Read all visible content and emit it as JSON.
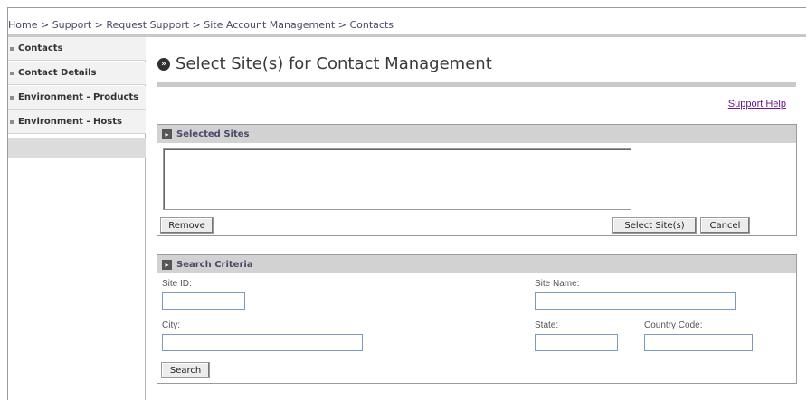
{
  "breadcrumb": "Home > Support > Request Support > Site Account Management > Contacts",
  "sidebar": {
    "items": [
      {
        "label": "Contacts"
      },
      {
        "label": "Contact Details"
      },
      {
        "label": "Environment - Products"
      },
      {
        "label": "Environment - Hosts"
      }
    ]
  },
  "page": {
    "title_icon": "»",
    "title": "Select Site(s) for Contact Management",
    "help_link": "Support Help"
  },
  "selected_sites": {
    "header": "Selected Sites",
    "list_value": "",
    "remove_label": "Remove",
    "select_label": "Select Site(s)",
    "cancel_label": "Cancel"
  },
  "search": {
    "header": "Search Criteria",
    "site_id_label": "Site ID:",
    "site_id_value": "",
    "site_name_label": "Site Name:",
    "site_name_value": "",
    "city_label": "City:",
    "city_value": "",
    "state_label": "State:",
    "state_value": "",
    "country_label": "Country Code:",
    "country_value": "",
    "search_label": "Search"
  },
  "colors": {
    "section_header_bg": "#d2d2d2",
    "nav_bg": "#f2f2f2",
    "link": "#6a1a8a",
    "field_border": "#7a9ac0"
  }
}
